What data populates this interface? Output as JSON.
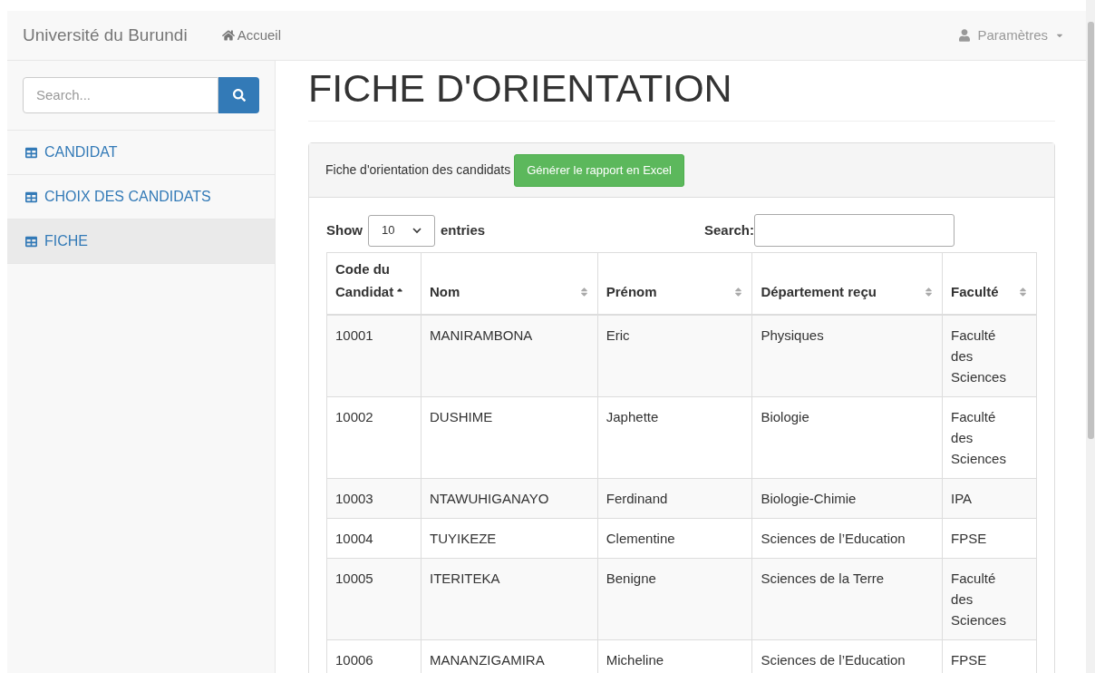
{
  "navbar": {
    "brand": "Université du Burundi",
    "home_link": "Accueil",
    "settings_menu": "Paramètres"
  },
  "sidebar": {
    "search": {
      "placeholder": "Search..."
    },
    "items": [
      {
        "label": "CANDIDAT",
        "selected": false
      },
      {
        "label": "CHOIX DES CANDIDATS",
        "selected": false
      },
      {
        "label": "FICHE",
        "selected": true
      }
    ]
  },
  "page_title": "FICHE D'ORIENTATION",
  "panel": {
    "heading": "Fiche d'orientation des candidats",
    "export_button": "Générer le rapport en Excel",
    "length_control": {
      "prefix": "Show",
      "value": "10",
      "suffix": "entries"
    },
    "search_label": "Search:",
    "table": {
      "columns": [
        {
          "label": "Code du Candidat",
          "sorted_ascending": true
        },
        {
          "label": "Nom",
          "sorted_ascending": false
        },
        {
          "label": "Prénom",
          "sorted_ascending": false
        },
        {
          "label": "Département reçu",
          "sorted_ascending": false
        },
        {
          "label": "Faculté",
          "sorted_ascending": false
        }
      ],
      "rows": [
        [
          "10001",
          "MANIRAMBONA",
          "Eric",
          "Physiques",
          "Faculté des Sciences"
        ],
        [
          "10002",
          "DUSHIME",
          "Japhette",
          "Biologie",
          "Faculté des Sciences"
        ],
        [
          "10003",
          "NTAWUHIGANAYO",
          "Ferdinand",
          "Biologie-Chimie",
          "IPA"
        ],
        [
          "10004",
          "TUYIKEZE",
          "Clementine",
          "Sciences de l’Education",
          "FPSE"
        ],
        [
          "10005",
          "ITERITEKA",
          "Benigne",
          "Sciences de la Terre",
          "Faculté des Sciences"
        ],
        [
          "10006",
          "MANANZIGAMIRA",
          "Micheline",
          "Sciences de l’Education",
          "FPSE"
        ]
      ]
    }
  }
}
